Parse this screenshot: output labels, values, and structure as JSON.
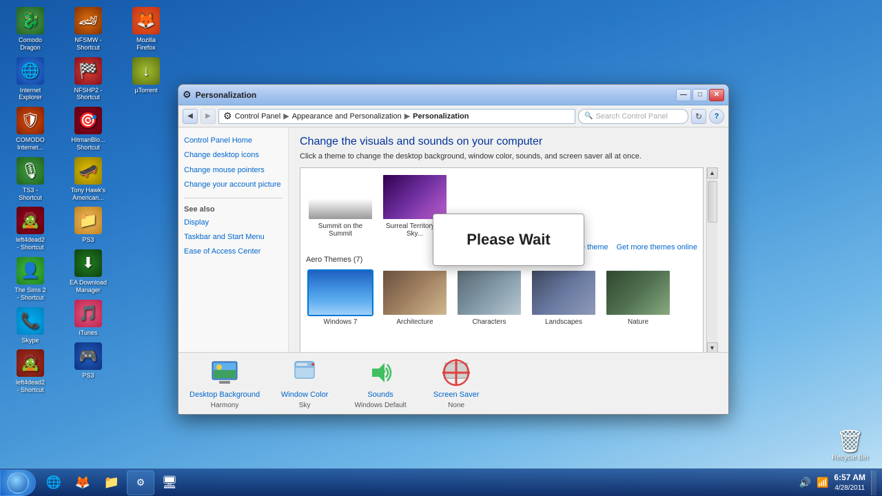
{
  "desktop": {
    "icons_col1": [
      {
        "name": "comodo-dragon-icon",
        "label": "Comodo\nDragon",
        "emoji": "🐉",
        "colorClass": "icon-comodo"
      },
      {
        "name": "ie-icon",
        "label": "Internet\nExplorer",
        "emoji": "🌐",
        "colorClass": "icon-ie"
      },
      {
        "name": "comodo-internet-icon",
        "label": "COMODO\nInternet...",
        "emoji": "🛡",
        "colorClass": "icon-comodo2"
      },
      {
        "name": "ts3-icon",
        "label": "TS3 -\nShortcut",
        "emoji": "🎙",
        "colorClass": "icon-ts3"
      },
      {
        "name": "left4dead-icon",
        "label": "left4dead2\n- Shortcut",
        "emoji": "🧟",
        "colorClass": "icon-left4dead"
      },
      {
        "name": "sims2-icon",
        "label": "The Sims 2\n- Shortcut",
        "emoji": "👤",
        "colorClass": "icon-sims"
      },
      {
        "name": "skype-icon",
        "label": "Skype",
        "emoji": "📞",
        "colorClass": "icon-skype"
      },
      {
        "name": "left4dead2-icon",
        "label": "left4dead2\n- Shortcut",
        "emoji": "🧟",
        "colorClass": "icon-left4dead2"
      }
    ],
    "icons_col2": [
      {
        "name": "nfsmw-icon",
        "label": "NFSMW -\nShortcut",
        "emoji": "🏎",
        "colorClass": "icon-nfsmw"
      },
      {
        "name": "nfshp-icon",
        "label": "NFSHP2 -\nShortcut",
        "emoji": "🏁",
        "colorClass": "icon-nfshp"
      },
      {
        "name": "hitman-icon",
        "label": "HitmanBlo...\nShortcut",
        "emoji": "🎯",
        "colorClass": "icon-hitman"
      },
      {
        "name": "tony-icon",
        "label": "Tony Hawk's\nAmerican...",
        "emoji": "🛹",
        "colorClass": "icon-tony"
      },
      {
        "name": "folder-icon",
        "label": "PS3",
        "emoji": "📁",
        "colorClass": "icon-folder"
      },
      {
        "name": "eadownload-icon",
        "label": "EA Download\nManager",
        "emoji": "⬇",
        "colorClass": "icon-eadownload"
      },
      {
        "name": "itunes-icon",
        "label": "iTunes",
        "emoji": "🎵",
        "colorClass": "icon-itunes"
      },
      {
        "name": "ps3-icon",
        "label": "PS3",
        "emoji": "🎮",
        "colorClass": "icon-ps3"
      }
    ],
    "icons_col3": [
      {
        "name": "firefox-icon",
        "label": "Mozilla\nFirefox",
        "emoji": "🦊",
        "colorClass": "icon-firefox"
      },
      {
        "name": "utorrent-icon",
        "label": "µTorrent",
        "emoji": "↓",
        "colorClass": "icon-utorrent"
      }
    ]
  },
  "window": {
    "title": "Personalization",
    "titlebar_buttons": {
      "minimize": "—",
      "maximize": "□",
      "close": "✕"
    }
  },
  "addressbar": {
    "back": "◀",
    "forward": "▶",
    "breadcrumb": "Control Panel ▶ Appearance and Personalization ▶ Personalization",
    "search_placeholder": "Search Control Panel"
  },
  "sidebar": {
    "home_label": "Control Panel Home",
    "links": [
      "Change desktop icons",
      "Change mouse pointers",
      "Change your account picture"
    ],
    "see_also_label": "See also",
    "see_also_links": [
      "Display",
      "Taskbar and Start Menu",
      "Ease of Access Center"
    ]
  },
  "main": {
    "title": "Change the visuals and sounds on your computer",
    "description": "Click a theme to change the desktop background, window color, sounds, and screen saver all at once.",
    "save_theme_label": "Save theme",
    "get_more_label": "Get more themes online",
    "themes_my_section": "",
    "themes_aero_label": "Aero Themes (7)",
    "themes": [
      {
        "id": "summit",
        "name": "Summit on the\nSummit",
        "colorClass": "thumb-summit-img"
      },
      {
        "id": "surreal",
        "name": "Surreal Territory by\nSin...",
        "colorClass": "thumb-surreal-img"
      },
      {
        "id": "windows7",
        "name": "Windows 7",
        "colorClass": "thumb-win7-img",
        "selected": true
      },
      {
        "id": "architecture",
        "name": "Architecture",
        "colorClass": "thumb-arch-img"
      },
      {
        "id": "characters",
        "name": "Characters",
        "colorClass": "thumb-chars-img"
      },
      {
        "id": "landscapes",
        "name": "Landscapes",
        "colorClass": "thumb-land-img"
      },
      {
        "id": "nature",
        "name": "Nature",
        "colorClass": "thumb-nature-img"
      }
    ]
  },
  "bottom_settings": [
    {
      "id": "desktop-bg",
      "emoji": "🖼",
      "label": "Desktop Background",
      "sublabel": "Harmony",
      "color": "#4a90d9"
    },
    {
      "id": "window-color",
      "emoji": "🪟",
      "label": "Window Color",
      "sublabel": "Sky",
      "color": "#aad4f0"
    },
    {
      "id": "sounds",
      "emoji": "🔊",
      "label": "Sounds",
      "sublabel": "Windows Default",
      "color": "#60c060"
    },
    {
      "id": "screen-saver",
      "emoji": "🚫",
      "label": "Screen Saver",
      "sublabel": "None",
      "color": "#e04040"
    }
  ],
  "please_wait": {
    "text": "Please Wait"
  },
  "taskbar": {
    "time": "6:57 AM",
    "date": "4/28/2011",
    "start_label": "Start"
  }
}
